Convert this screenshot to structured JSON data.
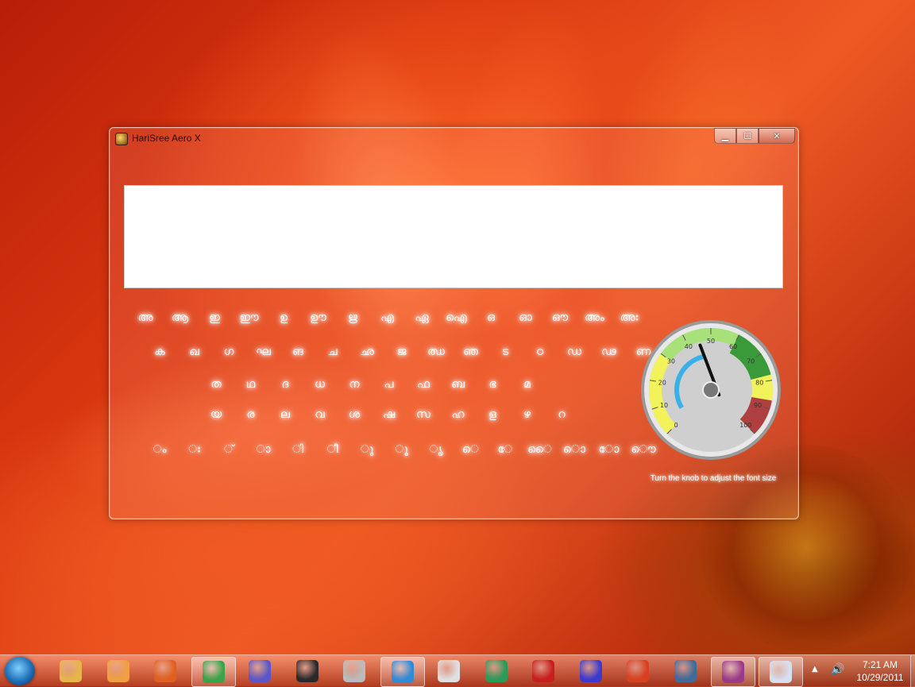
{
  "window": {
    "title": "HariSree Aero X",
    "min_symbol": "▁",
    "max_symbol": "☐",
    "close_symbol": "✕"
  },
  "keyboard": {
    "rows": [
      [
        "അ",
        "ആ",
        "ഇ",
        "ഈ",
        "ഉ",
        "ഊ",
        "ഋ",
        "എ",
        "ഏ",
        "ഐ",
        "ഒ",
        "ഓ",
        "ഔ",
        "അം",
        "അഃ"
      ],
      [
        "ക",
        "ഖ",
        "ഗ",
        "ഘ",
        "ങ",
        "ച",
        "ഛ",
        "ജ",
        "ഝ",
        "ഞ",
        "ട",
        "ഠ",
        "ഡ",
        "ഢ",
        "ണ"
      ],
      [
        "ത",
        "ഥ",
        "ദ",
        "ധ",
        "ന",
        "പ",
        "ഫ",
        "ബ",
        "ഭ",
        "മ"
      ],
      [
        "യ",
        "ര",
        "ല",
        "വ",
        "ശ",
        "ഷ",
        "സ",
        "ഹ",
        "ള",
        "ഴ",
        "റ"
      ],
      [
        "ം",
        "ഃ",
        "്",
        "ാ",
        "ി",
        "ീ",
        "ു",
        "ൂ",
        "ൃ",
        "െ",
        "േ",
        "ൈ",
        "ൊ",
        "ോ",
        "ൌ"
      ]
    ]
  },
  "gauge": {
    "ticks": [
      "0",
      "10",
      "20",
      "30",
      "40",
      "50",
      "60",
      "70",
      "80",
      "90",
      "100"
    ],
    "value": 45,
    "caption": "Turn the knob to adjust the font size",
    "colors": {
      "yellow": "#f2f25a",
      "light_green": "#a8e07a",
      "green": "#3a9a3a",
      "red": "#b04040",
      "blue": "#3ab0e8"
    }
  },
  "taskbar": {
    "items": [
      {
        "name": "explorer",
        "color": "#e7b64a"
      },
      {
        "name": "media-player",
        "color": "#f0a040"
      },
      {
        "name": "firefox",
        "color": "#e06020"
      },
      {
        "name": "chrome",
        "color": "#3aa34a",
        "active": true
      },
      {
        "name": "infinity",
        "color": "#5a58c8"
      },
      {
        "name": "media-um",
        "color": "#2a2a2a"
      },
      {
        "name": "app-winsoft",
        "color": "#bbbbbb"
      },
      {
        "name": "globe",
        "color": "#2f8ad8",
        "active": true
      },
      {
        "name": "installer",
        "color": "#e0e0e0"
      },
      {
        "name": "messenger",
        "color": "#2a9a5a"
      },
      {
        "name": "kaspersky",
        "color": "#c81e1e"
      },
      {
        "name": "bittorrent",
        "color": "#3a3ad0"
      },
      {
        "name": "ucweb",
        "color": "#d84020"
      },
      {
        "name": "monitor",
        "color": "#406a9a"
      },
      {
        "name": "winrar",
        "color": "#9a3a8a",
        "active": true
      },
      {
        "name": "window",
        "color": "#d8e0f0",
        "active": true
      }
    ],
    "clock": {
      "time": "7:21 AM",
      "date": "10/29/2011"
    },
    "tray_arrow": "▲",
    "volume_symbol": "🔊"
  }
}
